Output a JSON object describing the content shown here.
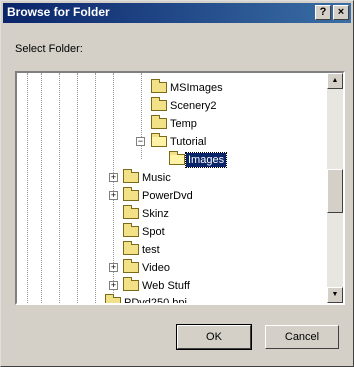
{
  "window": {
    "title": "Browse for Folder",
    "help_label": "?",
    "close_label": "×"
  },
  "prompt": "Select Folder:",
  "tree": {
    "items": [
      {
        "label": "MSImages"
      },
      {
        "label": "Scenery2"
      },
      {
        "label": "Temp"
      },
      {
        "label": "Tutorial",
        "expander": "−"
      },
      {
        "label": "Images",
        "selected": true
      },
      {
        "label": "Music",
        "expander": "+"
      },
      {
        "label": "PowerDvd",
        "expander": "+"
      },
      {
        "label": "Skinz"
      },
      {
        "label": "Spot"
      },
      {
        "label": "test"
      },
      {
        "label": "Video",
        "expander": "+"
      },
      {
        "label": "Web Stuff",
        "expander": "+"
      },
      {
        "label": "PDvd250.bpi"
      }
    ]
  },
  "scrollbar": {
    "up": "▲",
    "down": "▼"
  },
  "buttons": {
    "ok": "OK",
    "cancel": "Cancel"
  }
}
